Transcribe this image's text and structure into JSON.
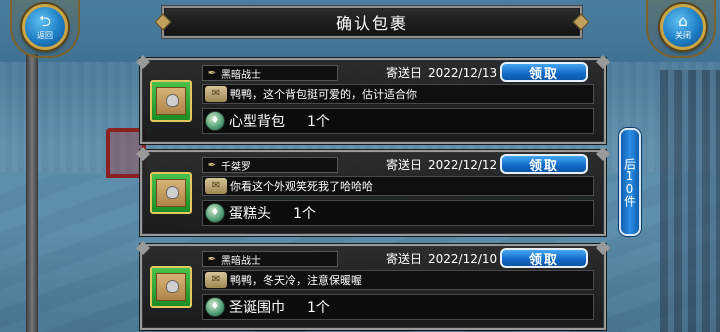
{
  "header": {
    "title": "确认包裹",
    "back_label": "返回",
    "close_label": "关闭"
  },
  "page_button": {
    "label": "后10件"
  },
  "mails": [
    {
      "sender": "黑暗战士",
      "date_label": "寄送日",
      "date": "2022/12/13",
      "claim_label": "领取",
      "message": "鸭鸭，这个背包挺可爱的，估计适合你",
      "item_name": "心型背包",
      "item_qty": "1个"
    },
    {
      "sender": "千桀罗",
      "date_label": "寄送日",
      "date": "2022/12/12",
      "claim_label": "领取",
      "message": "你看这个外观笑死我了哈哈哈",
      "item_name": "蛋糕头",
      "item_qty": "1个"
    },
    {
      "sender": "黑暗战士",
      "date_label": "寄送日",
      "date": "2022/12/10",
      "claim_label": "领取",
      "message": "鸭鸭，冬天冷，注意保暖喔",
      "item_name": "圣诞围巾",
      "item_qty": "1个"
    }
  ],
  "colors": {
    "accent_blue": "#1269c8",
    "frame_gold": "#c9a548",
    "panel_dark": "#161616"
  },
  "icons": {
    "back": "back-arrow-icon",
    "close": "home-icon",
    "package": "package-box-icon",
    "sender": "quill-icon",
    "message": "scroll-icon",
    "item": "potion-icon"
  }
}
